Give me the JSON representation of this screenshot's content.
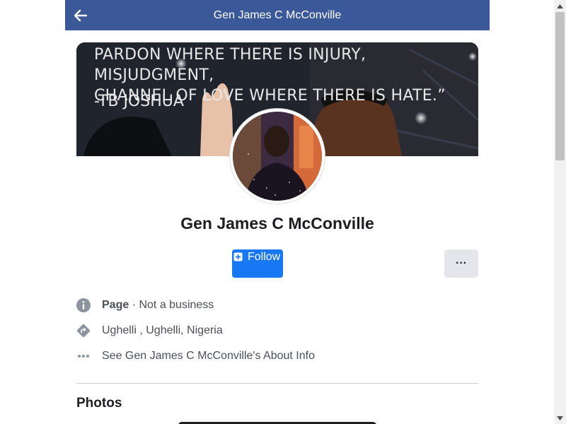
{
  "header": {
    "title": "Gen James C McConville",
    "back_icon": "arrow-left-icon",
    "background": "#3b5998"
  },
  "cover": {
    "quote": "PARDON WHERE THERE IS INJURY, MISJUDGMENT,\nCHANNEL OF LOVE WHERE THERE IS HATE.”",
    "author": "-TB JOSHUA"
  },
  "profile": {
    "name": "Gen James C McConville"
  },
  "actions": {
    "follow_label": "Follow",
    "follow_color": "#1877f2",
    "more_label": "···"
  },
  "info": {
    "page_label": "Page",
    "page_sep": " · ",
    "page_type": "Not a business",
    "location": "Ughelli , Ughelli, Nigeria",
    "about_link": "See Gen James C McConville's About Info"
  },
  "sections": {
    "photos_title": "Photos"
  }
}
